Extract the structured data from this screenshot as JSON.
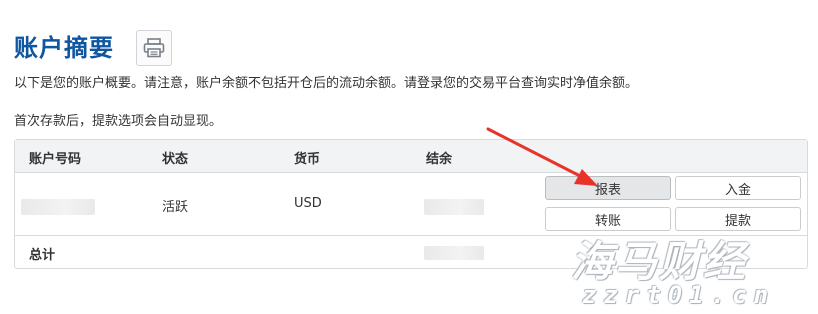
{
  "page": {
    "title": "账户摘要",
    "notice": "以下是您的账户概要。请注意，账户余额不包括开仓后的流动余额。请登录您的交易平台查询实时净值余额。",
    "notice2": "首次存款后，提款选项会自动显现。"
  },
  "icons": {
    "print": "printer-icon"
  },
  "table": {
    "headers": [
      "账户号码",
      "状态",
      "货币",
      "结余"
    ],
    "row": {
      "status": "活跃",
      "currency": "USD"
    },
    "total_label": "总计"
  },
  "actions": {
    "report": "报表",
    "deposit": "入金",
    "transfer": "转账",
    "withdraw": "提款"
  },
  "watermark": {
    "line1": "海马财经",
    "line2": "zzrt01.cn"
  },
  "colors": {
    "title": "#0f56a1",
    "arrow": "#e8332a",
    "header_bg": "#f1f3f5"
  }
}
